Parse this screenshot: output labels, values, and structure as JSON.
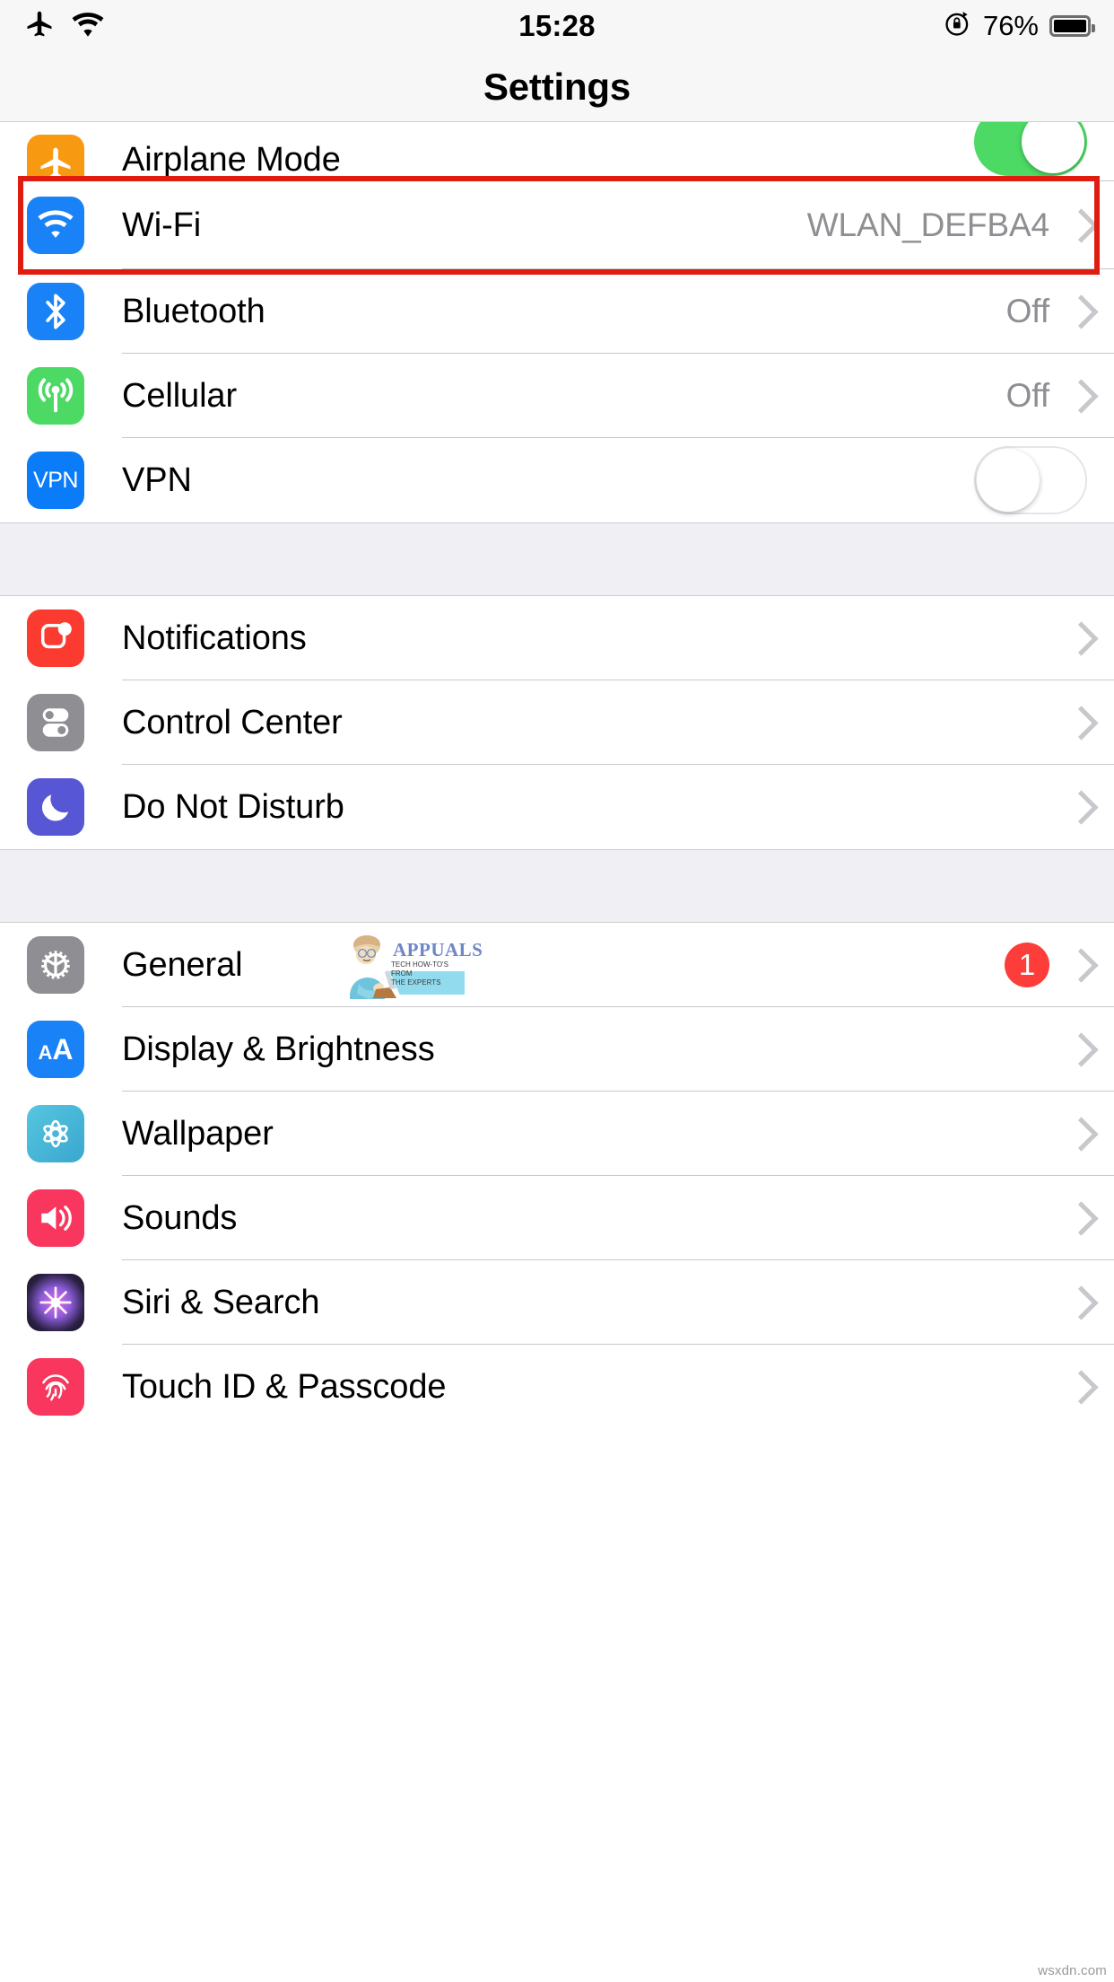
{
  "status_bar": {
    "airplane_icon": "airplane-icon",
    "wifi_icon": "wifi-icon",
    "time": "15:28",
    "rotation_lock_icon": "rotation-lock-icon",
    "battery_percent": "76%",
    "battery_icon": "battery-icon"
  },
  "nav": {
    "title": "Settings"
  },
  "groups": [
    {
      "id": "connectivity",
      "rows": [
        {
          "label": "Airplane Mode",
          "icon": "airplane-icon",
          "icon_color": "#f79a12",
          "accessory": "toggle",
          "toggle_on": true,
          "value": ""
        },
        {
          "label": "Wi-Fi",
          "icon": "wifi-icon",
          "icon_color": "#1a82f7",
          "accessory": "chevron",
          "value": "WLAN_DEFBA4",
          "highlighted": true
        },
        {
          "label": "Bluetooth",
          "icon": "bluetooth-icon",
          "icon_color": "#1a82f7",
          "accessory": "chevron",
          "value": "Off"
        },
        {
          "label": "Cellular",
          "icon": "cellular-icon",
          "icon_color": "#4cd964",
          "accessory": "chevron",
          "value": "Off"
        },
        {
          "label": "VPN",
          "icon": "vpn-icon",
          "icon_color": "#0a7cf7",
          "accessory": "toggle",
          "toggle_on": false,
          "value": ""
        }
      ]
    },
    {
      "id": "alerts",
      "rows": [
        {
          "label": "Notifications",
          "icon": "notifications-icon",
          "icon_color": "#fb3b30",
          "accessory": "chevron",
          "value": ""
        },
        {
          "label": "Control Center",
          "icon": "control-center-icon",
          "icon_color": "#8e8e93",
          "accessory": "chevron",
          "value": ""
        },
        {
          "label": "Do Not Disturb",
          "icon": "moon-icon",
          "icon_color": "#5756d5",
          "accessory": "chevron",
          "value": ""
        }
      ]
    },
    {
      "id": "system",
      "rows": [
        {
          "label": "General",
          "icon": "gear-icon",
          "icon_color": "#8e8e93",
          "accessory": "chevron",
          "badge": "1",
          "value": ""
        },
        {
          "label": "Display & Brightness",
          "icon": "display-brightness-icon",
          "icon_color": "#1a82f7",
          "accessory": "chevron",
          "value": ""
        },
        {
          "label": "Wallpaper",
          "icon": "wallpaper-icon",
          "icon_color": "#44b9d8",
          "accessory": "chevron",
          "value": ""
        },
        {
          "label": "Sounds",
          "icon": "sounds-icon",
          "icon_color": "#f8365e",
          "accessory": "chevron",
          "value": ""
        },
        {
          "label": "Siri & Search",
          "icon": "siri-icon",
          "icon_color": "#1b1b2e",
          "accessory": "chevron",
          "value": ""
        },
        {
          "label": "Touch ID & Passcode",
          "icon": "touch-id-icon",
          "icon_color": "#f8365e",
          "accessory": "chevron",
          "value": ""
        }
      ]
    }
  ],
  "highlight": {
    "target": "Wi-Fi",
    "color": "#e01b10"
  },
  "watermark": {
    "brand": "APPUALS",
    "tagline_line1": "TECH HOW-TO'S FROM",
    "tagline_line2": "THE EXPERTS"
  },
  "footer_credit": "wsxdn.com"
}
